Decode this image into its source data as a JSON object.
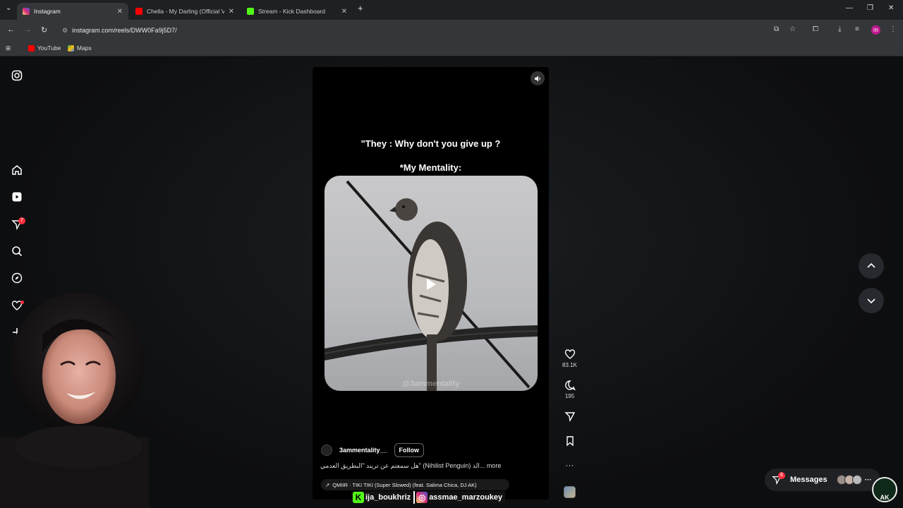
{
  "browser": {
    "tabs": [
      {
        "title": "Instagram",
        "active": true,
        "favicon_color": "#e1306c"
      },
      {
        "title": "Chella - My Darling (Official Vi",
        "active": false,
        "favicon_color": "#ff0000"
      },
      {
        "title": "Stream - Kick Dashboard",
        "active": false,
        "favicon_color": "#53fc18"
      }
    ],
    "url": "instagram.com/reels/DWW0Fa9j5D7/",
    "profile_initial": "m",
    "bookmarks": [
      {
        "label": "YouTube",
        "icon_color": "#ff0000"
      },
      {
        "label": "Maps",
        "icon_color": "#34a853"
      }
    ]
  },
  "sidebar": {
    "items": [
      {
        "name": "instagram-logo-icon"
      },
      {
        "name": "home-icon"
      },
      {
        "name": "reels-icon"
      },
      {
        "name": "direct-messages-icon",
        "badge": "7"
      },
      {
        "name": "search-icon"
      },
      {
        "name": "explore-icon"
      },
      {
        "name": "notifications-heart-icon"
      },
      {
        "name": "create-plus-icon"
      },
      {
        "name": "profile-avatar"
      }
    ]
  },
  "reel": {
    "line1": "\"They : Why don't you give up ?",
    "line2": "*My Mentality:",
    "watermark": "@3ammentality",
    "author": "3ammentality__",
    "follow_label": "Follow",
    "description": "هل سمعتم عن تريند \"البطريق العدمي\" (Nihilist Penguin) الذ... more",
    "audio": "QMIIR · TIKI TIKI (Super Slowed) (feat. Salima Chica, DJ AK)",
    "likes": "83.1K",
    "comments": "195"
  },
  "stream_overlay": {
    "kick_handle": "ija_boukhriz",
    "instagram_handle": "assmae_marzoukey"
  },
  "messages": {
    "label": "Messages",
    "badge": "6"
  },
  "watermark_logo": "AK",
  "colors": {
    "accent_red": "#ff3040",
    "kick_green": "#53fc18"
  }
}
